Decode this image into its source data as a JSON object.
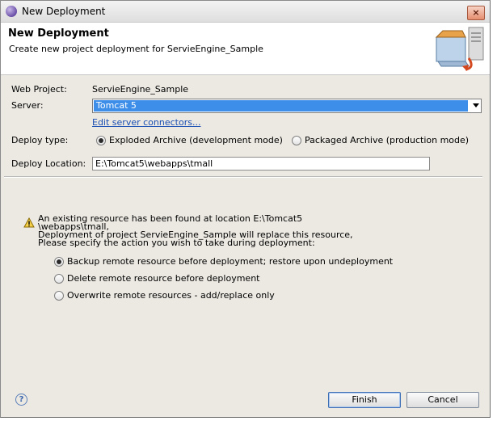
{
  "window": {
    "title": "New Deployment",
    "close_icon": "×"
  },
  "banner": {
    "title": "New Deployment",
    "description": "Create new project deployment for ServieEngine_Sample"
  },
  "form": {
    "web_project_label": "Web Project:",
    "web_project_value": "ServieEngine_Sample",
    "server_label": "Server:",
    "server_value": "Tomcat 5",
    "edit_link": "Edit server connectors...",
    "deploy_type_label": "Deploy type:",
    "deploy_type_options": [
      "Exploded Archive (development mode)",
      "Packaged Archive (production mode)"
    ],
    "deploy_type_selected": 0,
    "deploy_location_label": "Deploy Location:",
    "deploy_location_value": "E:\\Tomcat5\\webapps\\tmall"
  },
  "warning": {
    "message": "An existing resource has been found at location E:\\Tomcat5\n\\webapps\\tmall,\nDeployment of project ServieEngine_Sample will replace this resource,\nPlease specify the action you wish to take during deployment:",
    "options": [
      "Backup remote resource before deployment; restore upon undeployment",
      "Delete remote resource before deployment",
      "Overwrite remote resources - add/replace only"
    ],
    "selected": 0
  },
  "footer": {
    "help_icon": "?",
    "finish_label": "Finish",
    "cancel_label": "Cancel"
  }
}
